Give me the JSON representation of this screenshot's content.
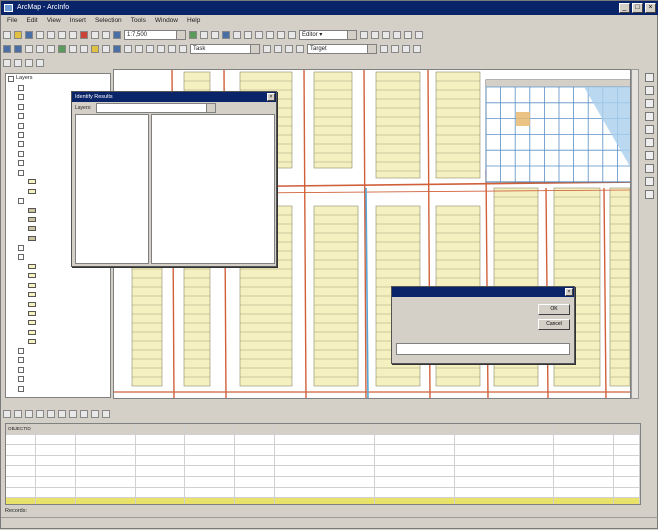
{
  "window": {
    "title": "ArcMap - ArcInfo"
  },
  "menu": [
    "File",
    "Edit",
    "View",
    "Insert",
    "Selection",
    "Tools",
    "Window",
    "Help"
  ],
  "toolbar": {
    "scale": "1:7,500",
    "editor_label": "Editor ▾",
    "task_label": "Task",
    "target_label": "Target"
  },
  "toc": {
    "layers": [
      {
        "label": "Layers",
        "indent": 0,
        "type": "group"
      },
      {
        "label": "",
        "indent": 1,
        "type": "check"
      },
      {
        "label": "",
        "indent": 1,
        "type": "check"
      },
      {
        "label": "",
        "indent": 1,
        "type": "check"
      },
      {
        "label": "",
        "indent": 1,
        "type": "check"
      },
      {
        "label": "",
        "indent": 1,
        "type": "check"
      },
      {
        "label": "",
        "indent": 1,
        "type": "check"
      },
      {
        "label": "",
        "indent": 1,
        "type": "check"
      },
      {
        "label": "",
        "indent": 1,
        "type": "check"
      },
      {
        "label": "",
        "indent": 1,
        "type": "check"
      },
      {
        "label": "",
        "indent": 1,
        "type": "check"
      },
      {
        "label": "",
        "indent": 2,
        "type": "swatch",
        "color": "#f5f0c0"
      },
      {
        "label": "",
        "indent": 2,
        "type": "swatch",
        "color": "#f5f0c0"
      },
      {
        "label": "",
        "indent": 1,
        "type": "check"
      },
      {
        "label": "",
        "indent": 2,
        "type": "swatch",
        "color": "#c9c3a4"
      },
      {
        "label": "",
        "indent": 2,
        "type": "swatch",
        "color": "#c9c3a4"
      },
      {
        "label": "",
        "indent": 2,
        "type": "swatch",
        "color": "#c9c3a4"
      },
      {
        "label": "",
        "indent": 2,
        "type": "swatch",
        "color": "#c9c3a4"
      },
      {
        "label": "",
        "indent": 1,
        "type": "check"
      },
      {
        "label": "",
        "indent": 1,
        "type": "check"
      },
      {
        "label": "",
        "indent": 2,
        "type": "swatch",
        "color": "#f5f0c0"
      },
      {
        "label": "",
        "indent": 2,
        "type": "swatch",
        "color": "#f5f0c0"
      },
      {
        "label": "",
        "indent": 2,
        "type": "swatch",
        "color": "#f5f0c0"
      },
      {
        "label": "",
        "indent": 2,
        "type": "swatch",
        "color": "#f5f0c0"
      },
      {
        "label": "",
        "indent": 2,
        "type": "swatch",
        "color": "#f5f0c0"
      },
      {
        "label": "",
        "indent": 2,
        "type": "swatch",
        "color": "#f5f0c0"
      },
      {
        "label": "",
        "indent": 2,
        "type": "swatch",
        "color": "#f5f0c0"
      },
      {
        "label": "",
        "indent": 2,
        "type": "swatch",
        "color": "#f5f0c0"
      },
      {
        "label": "",
        "indent": 2,
        "type": "swatch",
        "color": "#f5f0c0"
      },
      {
        "label": "",
        "indent": 1,
        "type": "check"
      },
      {
        "label": "",
        "indent": 1,
        "type": "check"
      },
      {
        "label": "",
        "indent": 1,
        "type": "check"
      },
      {
        "label": "",
        "indent": 1,
        "type": "check"
      },
      {
        "label": "",
        "indent": 1,
        "type": "check"
      }
    ]
  },
  "identify": {
    "title": "Identify Results",
    "layers_label": "Layers:",
    "layers_value": "",
    "tree": [],
    "header": "",
    "attributes": []
  },
  "edit_dialog": {
    "title": "",
    "prompt": "",
    "ok": "OK",
    "cancel": "Cancel",
    "field": ""
  },
  "table": {
    "columns": [
      "OBJECTID",
      "",
      "",
      "",
      "",
      "",
      "",
      "",
      "",
      "",
      ""
    ],
    "rows": [
      {
        "selected": false,
        "cells": [
          "",
          "",
          "",
          "",
          "",
          "",
          "",
          "",
          "",
          "",
          ""
        ]
      },
      {
        "selected": false,
        "cells": [
          "",
          "",
          "",
          "",
          "",
          "",
          "",
          "",
          "",
          "",
          ""
        ]
      },
      {
        "selected": false,
        "cells": [
          "",
          "",
          "",
          "",
          "",
          "",
          "",
          "",
          "",
          "",
          ""
        ]
      },
      {
        "selected": false,
        "cells": [
          "",
          "",
          "",
          "",
          "",
          "",
          "",
          "",
          "",
          "",
          ""
        ]
      },
      {
        "selected": false,
        "cells": [
          "",
          "",
          "",
          "",
          "",
          "",
          "",
          "",
          "",
          "",
          ""
        ]
      },
      {
        "selected": false,
        "cells": [
          "",
          "",
          "",
          "",
          "",
          "",
          "",
          "",
          "",
          "",
          ""
        ]
      },
      {
        "selected": true,
        "cells": [
          "",
          "",
          "",
          "",
          "",
          "",
          "",
          "",
          "",
          "",
          ""
        ]
      }
    ]
  },
  "records_label": "Records:",
  "status": {
    "left": "",
    "right": ""
  },
  "colors": {
    "parcel_fill": "#f5f0c0",
    "parcel_line": "#8a8a6a",
    "road": "#d0603a",
    "highlight": "#5aa7d6",
    "selection_row": "#e8e26a",
    "title_bar": "#0a246a"
  }
}
